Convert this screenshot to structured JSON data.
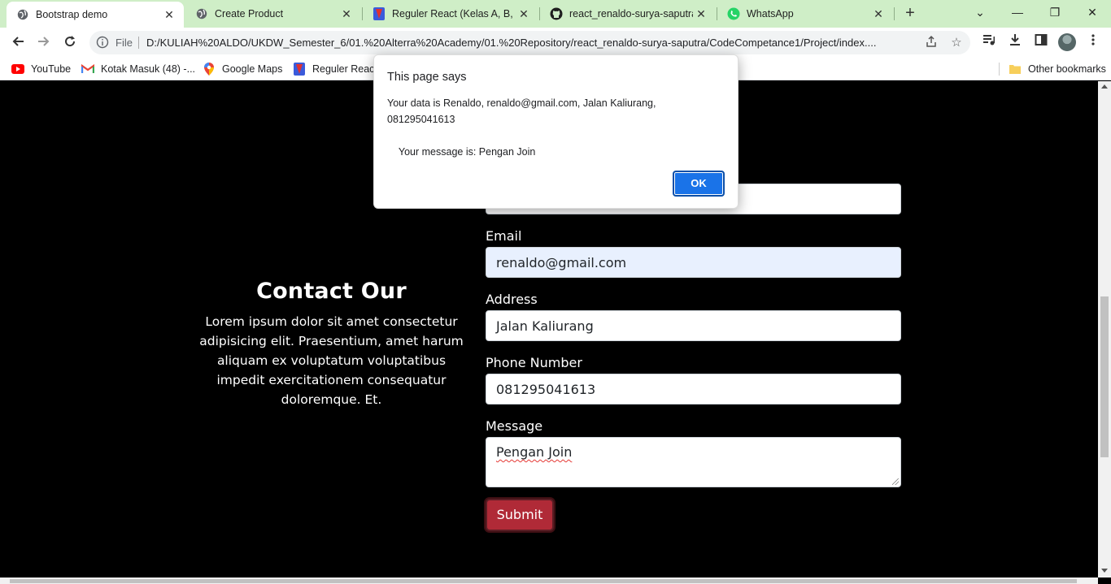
{
  "tabs": [
    {
      "title": "Bootstrap demo",
      "icon": "globe-icon",
      "active": true
    },
    {
      "title": "Create Product",
      "icon": "globe-icon",
      "active": false
    },
    {
      "title": "Reguler React (Kelas A, B, dan",
      "icon": "alterra-icon",
      "active": false
    },
    {
      "title": "react_renaldo-surya-saputra/",
      "icon": "github-icon",
      "active": false
    },
    {
      "title": "WhatsApp",
      "icon": "whatsapp-icon",
      "active": false
    }
  ],
  "tab_close_glyph": "✕",
  "new_tab_glyph": "+",
  "window_controls": {
    "dropdown": "⌄",
    "minimize": "—",
    "restore": "❐",
    "close": "✕"
  },
  "address_bar": {
    "scheme_label": "File",
    "url": "D:/KULIAH%20ALDO/UKDW_Semester_6/01.%20Alterra%20Academy/01.%20Repository/react_renaldo-surya-saputra/CodeCompetance1/Project/index...."
  },
  "bookmarks": [
    {
      "label": "YouTube",
      "icon": "youtube-icon"
    },
    {
      "label": "Kotak Masuk (48) -...",
      "icon": "gmail-icon"
    },
    {
      "label": "Google Maps",
      "icon": "maps-icon"
    },
    {
      "label": "Reguler React",
      "icon": "alterra-icon"
    }
  ],
  "other_bookmarks": "Other bookmarks",
  "contact": {
    "heading": "Contact Our",
    "body": "Lorem ipsum dolor sit amet consectetur adipisicing elit. Praesentium, amet harum aliquam ex voluptatum voluptatibus impedit exercitationem consequatur doloremque. Et."
  },
  "form": {
    "email_label": "Email",
    "email_value": "renaldo@gmail.com",
    "address_label": "Address",
    "address_value": "Jalan Kaliurang",
    "phone_label": "Phone Number",
    "phone_value": "081295041613",
    "message_label": "Message",
    "message_value": "Pengan Join",
    "submit_label": "Submit"
  },
  "dialog": {
    "title": "This page says",
    "message": "Your data is Renaldo, renaldo@gmail.com, Jalan Kaliurang,\n081295041613\n\n    Your message is: Pengan Join",
    "ok_label": "OK"
  },
  "colors": {
    "tabstrip": "#cfeec7",
    "submit": "#b02a37",
    "ok_button": "#1a73e8",
    "autofill": "#e8f0fe"
  }
}
